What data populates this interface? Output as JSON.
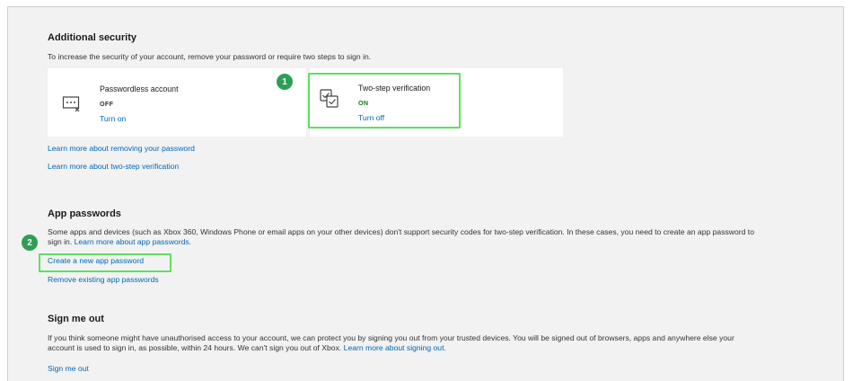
{
  "additional_security": {
    "title": "Additional security",
    "description": "To increase the security of your account, remove your password or require two steps to sign in.",
    "passwordless": {
      "title": "Passwordless account",
      "status": "OFF",
      "action": "Turn on"
    },
    "two_step": {
      "title": "Two-step verification",
      "status": "ON",
      "action": "Turn off"
    },
    "links": [
      "Learn more about removing your password",
      "Learn more about two-step verification"
    ]
  },
  "app_passwords": {
    "title": "App passwords",
    "description_line1": "Some apps and devices (such as Xbox 360, Windows Phone or email apps on your other devices) don't support security codes for two-step verification. In these cases, you need to create an app password to",
    "description_line2": "sign in.",
    "learn_more": "Learn more about app passwords.",
    "create": "Create a new app password",
    "remove": "Remove existing app passwords"
  },
  "sign_out": {
    "title": "Sign me out",
    "description_line1": "If you think someone might have unauthorised access to your account, we can protect you by signing you out from your trusted devices. You will be signed out of browsers, apps and anywhere else your",
    "description_line2": "account is used to sign in, as possible, within 24 hours. We can't sign you out of Xbox.",
    "learn_more": "Learn more about signing out.",
    "action": "Sign me out"
  },
  "annotations": {
    "badge1": "1",
    "badge2": "2"
  },
  "colors": {
    "highlight": "#5fe060",
    "badge": "#2e9e57",
    "link": "#0067b8",
    "on": "#107c10"
  }
}
